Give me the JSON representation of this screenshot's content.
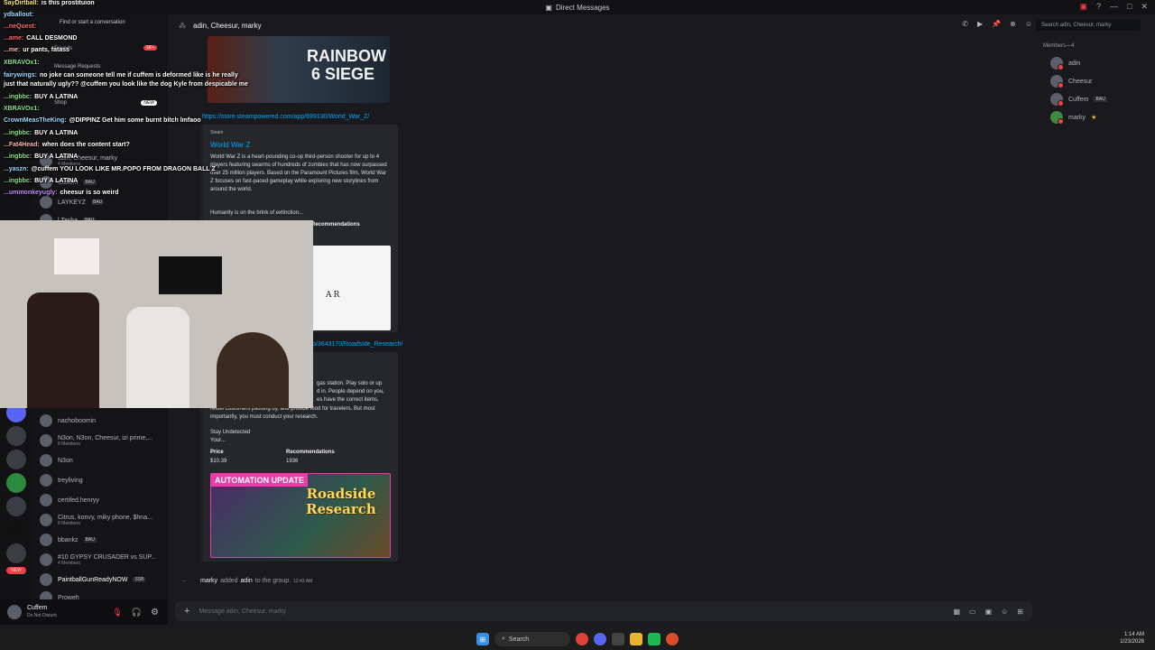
{
  "window": {
    "title": "Direct Messages"
  },
  "header": {
    "channel_name": "adin, Cheesur, marky",
    "search_placeholder": "Search adin, Cheesur, marky"
  },
  "sidebar": {
    "find_placeholder": "Find or start a conversation",
    "friends_label": "Friends",
    "message_requests_label": "Message Requests",
    "friends_badge": "1K+",
    "shop_label": "Shop",
    "shop_badge": "NEW",
    "dms": [
      {
        "name": "adin, Cheesur, marky",
        "sub": "4 Members"
      },
      {
        "name": "Cuffem",
        "tag": "BAU"
      },
      {
        "name": "LAYKEYZ",
        "tag": "BAU"
      },
      {
        "name": "l Tasha",
        "tag": "BAU"
      },
      {
        "name": "nachoboomin"
      },
      {
        "name": "N3on, N3on, Cheesur, izi prime,...",
        "sub": "8 Members"
      },
      {
        "name": "N3on"
      },
      {
        "name": "treyliving"
      },
      {
        "name": "certifed.henryy"
      },
      {
        "name": "Citrus, konvy, miky phone, $hna...",
        "sub": "8 Members"
      },
      {
        "name": "bbankz",
        "tag": "BAU"
      },
      {
        "name": "#10 GYPSY CRUSADER vs SUP...",
        "sub": "4 Members"
      },
      {
        "name": "PaintballGunReadyNOW",
        "tag": "SSB"
      },
      {
        "name": "Proweh"
      }
    ]
  },
  "user_panel": {
    "name": "Cuffem",
    "status": "Do Not Disturb"
  },
  "embeds": {
    "siege_banner_text": "RAINBOW 6 SIEGE",
    "wwz_url": "https://store.steampowered.com/app/699130/World_War_Z/",
    "wwz_provider": "Steam",
    "wwz_title": "World War Z",
    "wwz_desc": "World War Z is a heart-pounding co-op third-person shooter for up to 4 players featuring swarms of hundreds of zombies that has now surpassed over 25 million players. Based on the Paramount Pictures film, World War Z focuses on fast-paced gameplay while exploring new storylines from around the world.",
    "wwz_tail": "Humanity is on the brink of extinction...",
    "wwz_rec_label": "Recommendations",
    "wwz_image_text": "AR",
    "roadside_url_tail": "p/3643170/Roadside_Research/",
    "roadside_desc_a": "gas station. Play solo or up",
    "roadside_desc_b": "d in. People depend on you,",
    "roadside_desc_c": "es have the correct items,",
    "roadside_desc_d": "refuel customers passing by, and provide food for travelers. But most importantly, you must conduct your research.",
    "roadside_tail1": "Stay Undetected",
    "roadside_tail2": "Your...",
    "price_label": "Price",
    "price_value": "$10.39",
    "rec_label": "Recommendations",
    "rec_value": "1936",
    "roadside_banner_tag": "AUTOMATION UPDATE",
    "roadside_banner_title": "Roadside Research"
  },
  "system_message": {
    "actor": "marky",
    "verb": "added",
    "target": "adin",
    "rest": "to the group.",
    "time": "12:43 AM"
  },
  "composer": {
    "placeholder": "Message adin, Cheesur, marky"
  },
  "members": {
    "header": "Members—4",
    "list": [
      {
        "name": "adin"
      },
      {
        "name": "Cheesur"
      },
      {
        "name": "Cuffem",
        "tag": "BAU"
      },
      {
        "name": "marky",
        "emoji": "★"
      }
    ]
  },
  "chat_overlay": [
    {
      "user": "SayDirtball:",
      "color": "#f5e663",
      "msg": "is this prostituion"
    },
    {
      "user": "ydballout:",
      "color": "#9ad9ff",
      "msg": ""
    },
    {
      "user": "...neQuest:",
      "color": "#ff6b6b",
      "msg": ""
    },
    {
      "user": "...ame:",
      "color": "#ff6b6b",
      "msg": "CALL DESMOND"
    },
    {
      "user": "...me:",
      "color": "#ffb3b3",
      "msg": "ur pants, fatass"
    },
    {
      "user": "XBRAVOx1:",
      "color": "#8be38b",
      "msg": ""
    },
    {
      "user": "fairywings:",
      "color": "#9ad9ff",
      "msg": "no joke can someone tell me if cuffem is deformed like is he really"
    },
    {
      "user": "",
      "color": "#fff",
      "msg": "just that naturally ugly?? @cuffem you look like the dog Kyle from despicable me"
    },
    {
      "user": "...ingbbc:",
      "color": "#8be38b",
      "msg": "BUY A LATINA"
    },
    {
      "user": "XBRAVOx1:",
      "color": "#8be38b",
      "msg": ""
    },
    {
      "user": "CrownMeasTheKing:",
      "color": "#9ad9ff",
      "msg": "@DIPPINZ Get him some burnt bitch lmfaoo"
    },
    {
      "user": "...ingbbc:",
      "color": "#8be38b",
      "msg": "BUY A LATINA"
    },
    {
      "user": "...Fat4Head:",
      "color": "#ffb3b3",
      "msg": "when does the content start?"
    },
    {
      "user": "...ingbbc:",
      "color": "#8be38b",
      "msg": "BUY A LATINA"
    },
    {
      "user": "...yaszn:",
      "color": "#9ad9ff",
      "msg": "@cuffem YOU LOOK LIKE MR.POPO FROM DRAGON BALL Z"
    },
    {
      "user": "...ingbbc:",
      "color": "#8be38b",
      "msg": "BUY A LATINA"
    },
    {
      "user": "...ummonkeyugly:",
      "color": "#c68bff",
      "msg": "cheesur is so weird"
    }
  ],
  "taskbar": {
    "search_label": "Search",
    "time": "1:14 AM",
    "date": "1/23/2026"
  },
  "colors": {
    "link": "#00a8fc",
    "accent": "#5865f2",
    "dnd": "#f23f43",
    "roadside_pink": "#e83eaa"
  }
}
